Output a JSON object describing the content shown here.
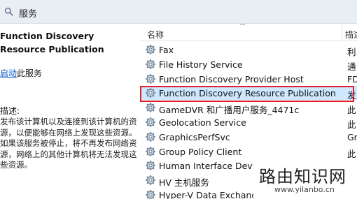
{
  "window": {
    "title": "服务"
  },
  "detail": {
    "service_name": "Function Discovery Resource Publication",
    "start_link": "启动",
    "start_suffix": "此服务",
    "description_label": "描述:",
    "description": "发布该计算机以及连接到该计算机的资源，以便能够在网络上发现这些资源。如果该服务被停止，将不再发布网络资源，网络上的其他计算机将无法发现这些资源。"
  },
  "list": {
    "col_name": "名称",
    "col_description": "描述",
    "sort_indicator": "^",
    "rows": [
      {
        "name": "Fax",
        "desc": "利"
      },
      {
        "name": "File History Service",
        "desc": "通"
      },
      {
        "name": "Function Discovery Provider Host",
        "desc": "FD"
      },
      {
        "name": "Function Discovery Resource Publication",
        "desc": "发"
      },
      {
        "name": "GameDVR 和广播用户服务_4471c",
        "desc": "此"
      },
      {
        "name": "Geolocation Service",
        "desc": "此"
      },
      {
        "name": "GraphicsPerfSvc",
        "desc": "Gr"
      },
      {
        "name": "Group Policy Client",
        "desc": "此"
      },
      {
        "name": "Human Interface Device Service",
        "desc": ""
      },
      {
        "name": "HV 主机服务",
        "desc": ""
      },
      {
        "name": "Hyper-V Data Exchange Service",
        "desc": ""
      }
    ],
    "selected_index": 3
  },
  "watermark": {
    "text": "路由知识网",
    "url": "www.yilanbo.cn"
  },
  "colors": {
    "selection": "#cde8ff",
    "highlight_box": "#e0202a",
    "link": "#0b57c8"
  }
}
